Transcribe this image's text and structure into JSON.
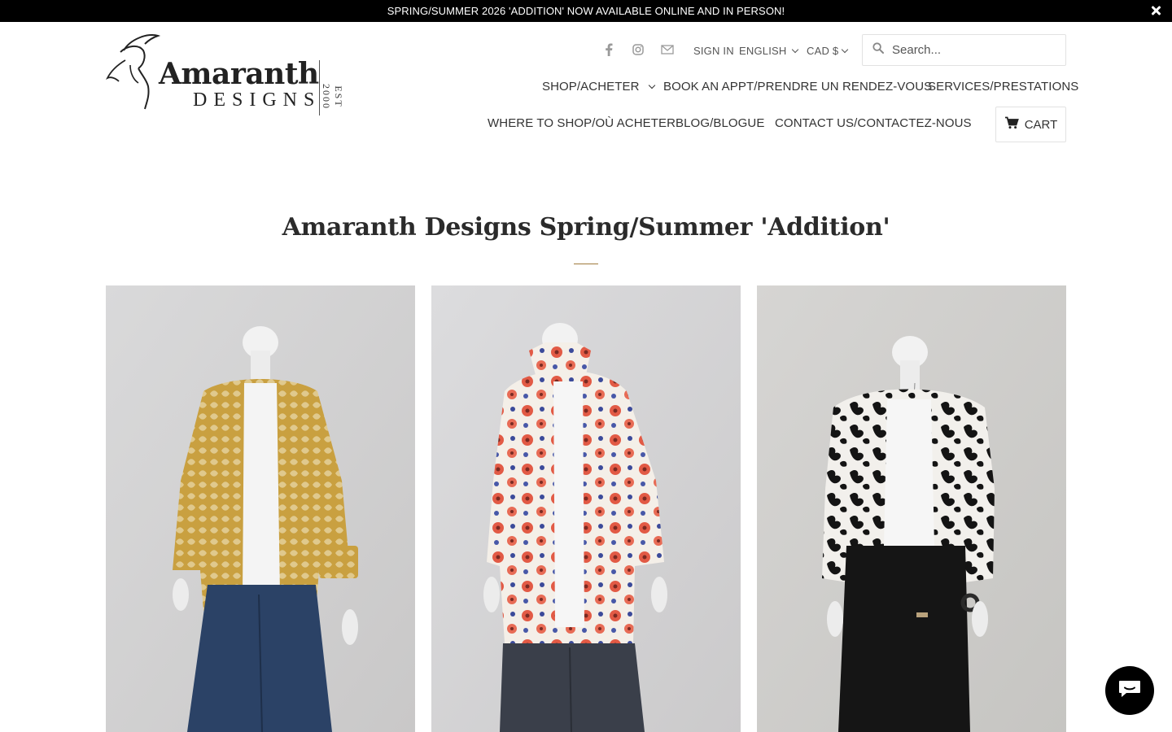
{
  "announcement": {
    "text": "SPRING/SUMMER 2026 'ADDITION' NOW AVAILABLE ONLINE AND IN PERSON!",
    "close_icon": "close-icon"
  },
  "logo": {
    "name": "Amaranth",
    "sub": "DESIGNS",
    "est": "EST 2000"
  },
  "utility": {
    "social_icons": [
      "facebook-icon",
      "instagram-icon",
      "email-icon"
    ],
    "sign_in": "SIGN IN",
    "language": "ENGLISH",
    "currency": "CAD $"
  },
  "search": {
    "placeholder": "Search..."
  },
  "nav": {
    "shop": "SHOP/ACHETER",
    "book": "BOOK AN APPT/PRENDRE UN RENDEZ-VOUS",
    "services": "SERVICES/PRESTATIONS",
    "where": "WHERE TO SHOP/OÙ ACHETER",
    "blog": "BLOG/BLOGUE",
    "contact": "CONTACT US/CONTACTEZ-NOUS",
    "cart": "CART"
  },
  "collection": {
    "title": "Amaranth Designs Spring/Summer 'Addition'",
    "products": [
      {
        "jacket_color": "#c9a040",
        "pants_color": "#2b4266"
      },
      {
        "jacket_color": "#f4efe8",
        "pants_color": "#3a3f4a"
      },
      {
        "jacket_color": "#f2f0ec",
        "pants_color": "#151515"
      }
    ]
  },
  "colors": {
    "announcement_bg": "#000000",
    "title_rule": "#a07a3c",
    "chat_button": "#000000"
  }
}
